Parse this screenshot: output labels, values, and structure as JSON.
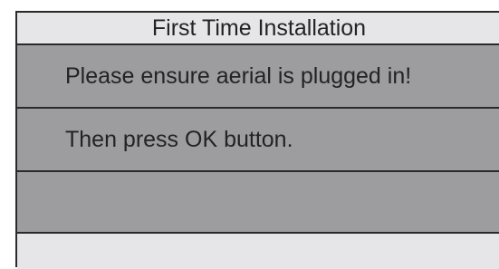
{
  "dialog": {
    "title": "First Time Installation",
    "message_line_1": "Please ensure aerial is plugged in!",
    "message_line_2": "Then press OK button."
  },
  "colors": {
    "title_bar_bg": "#e6e6e8",
    "body_bg": "#9d9d9f",
    "border": "#2a2a2a",
    "text": "#232323"
  }
}
